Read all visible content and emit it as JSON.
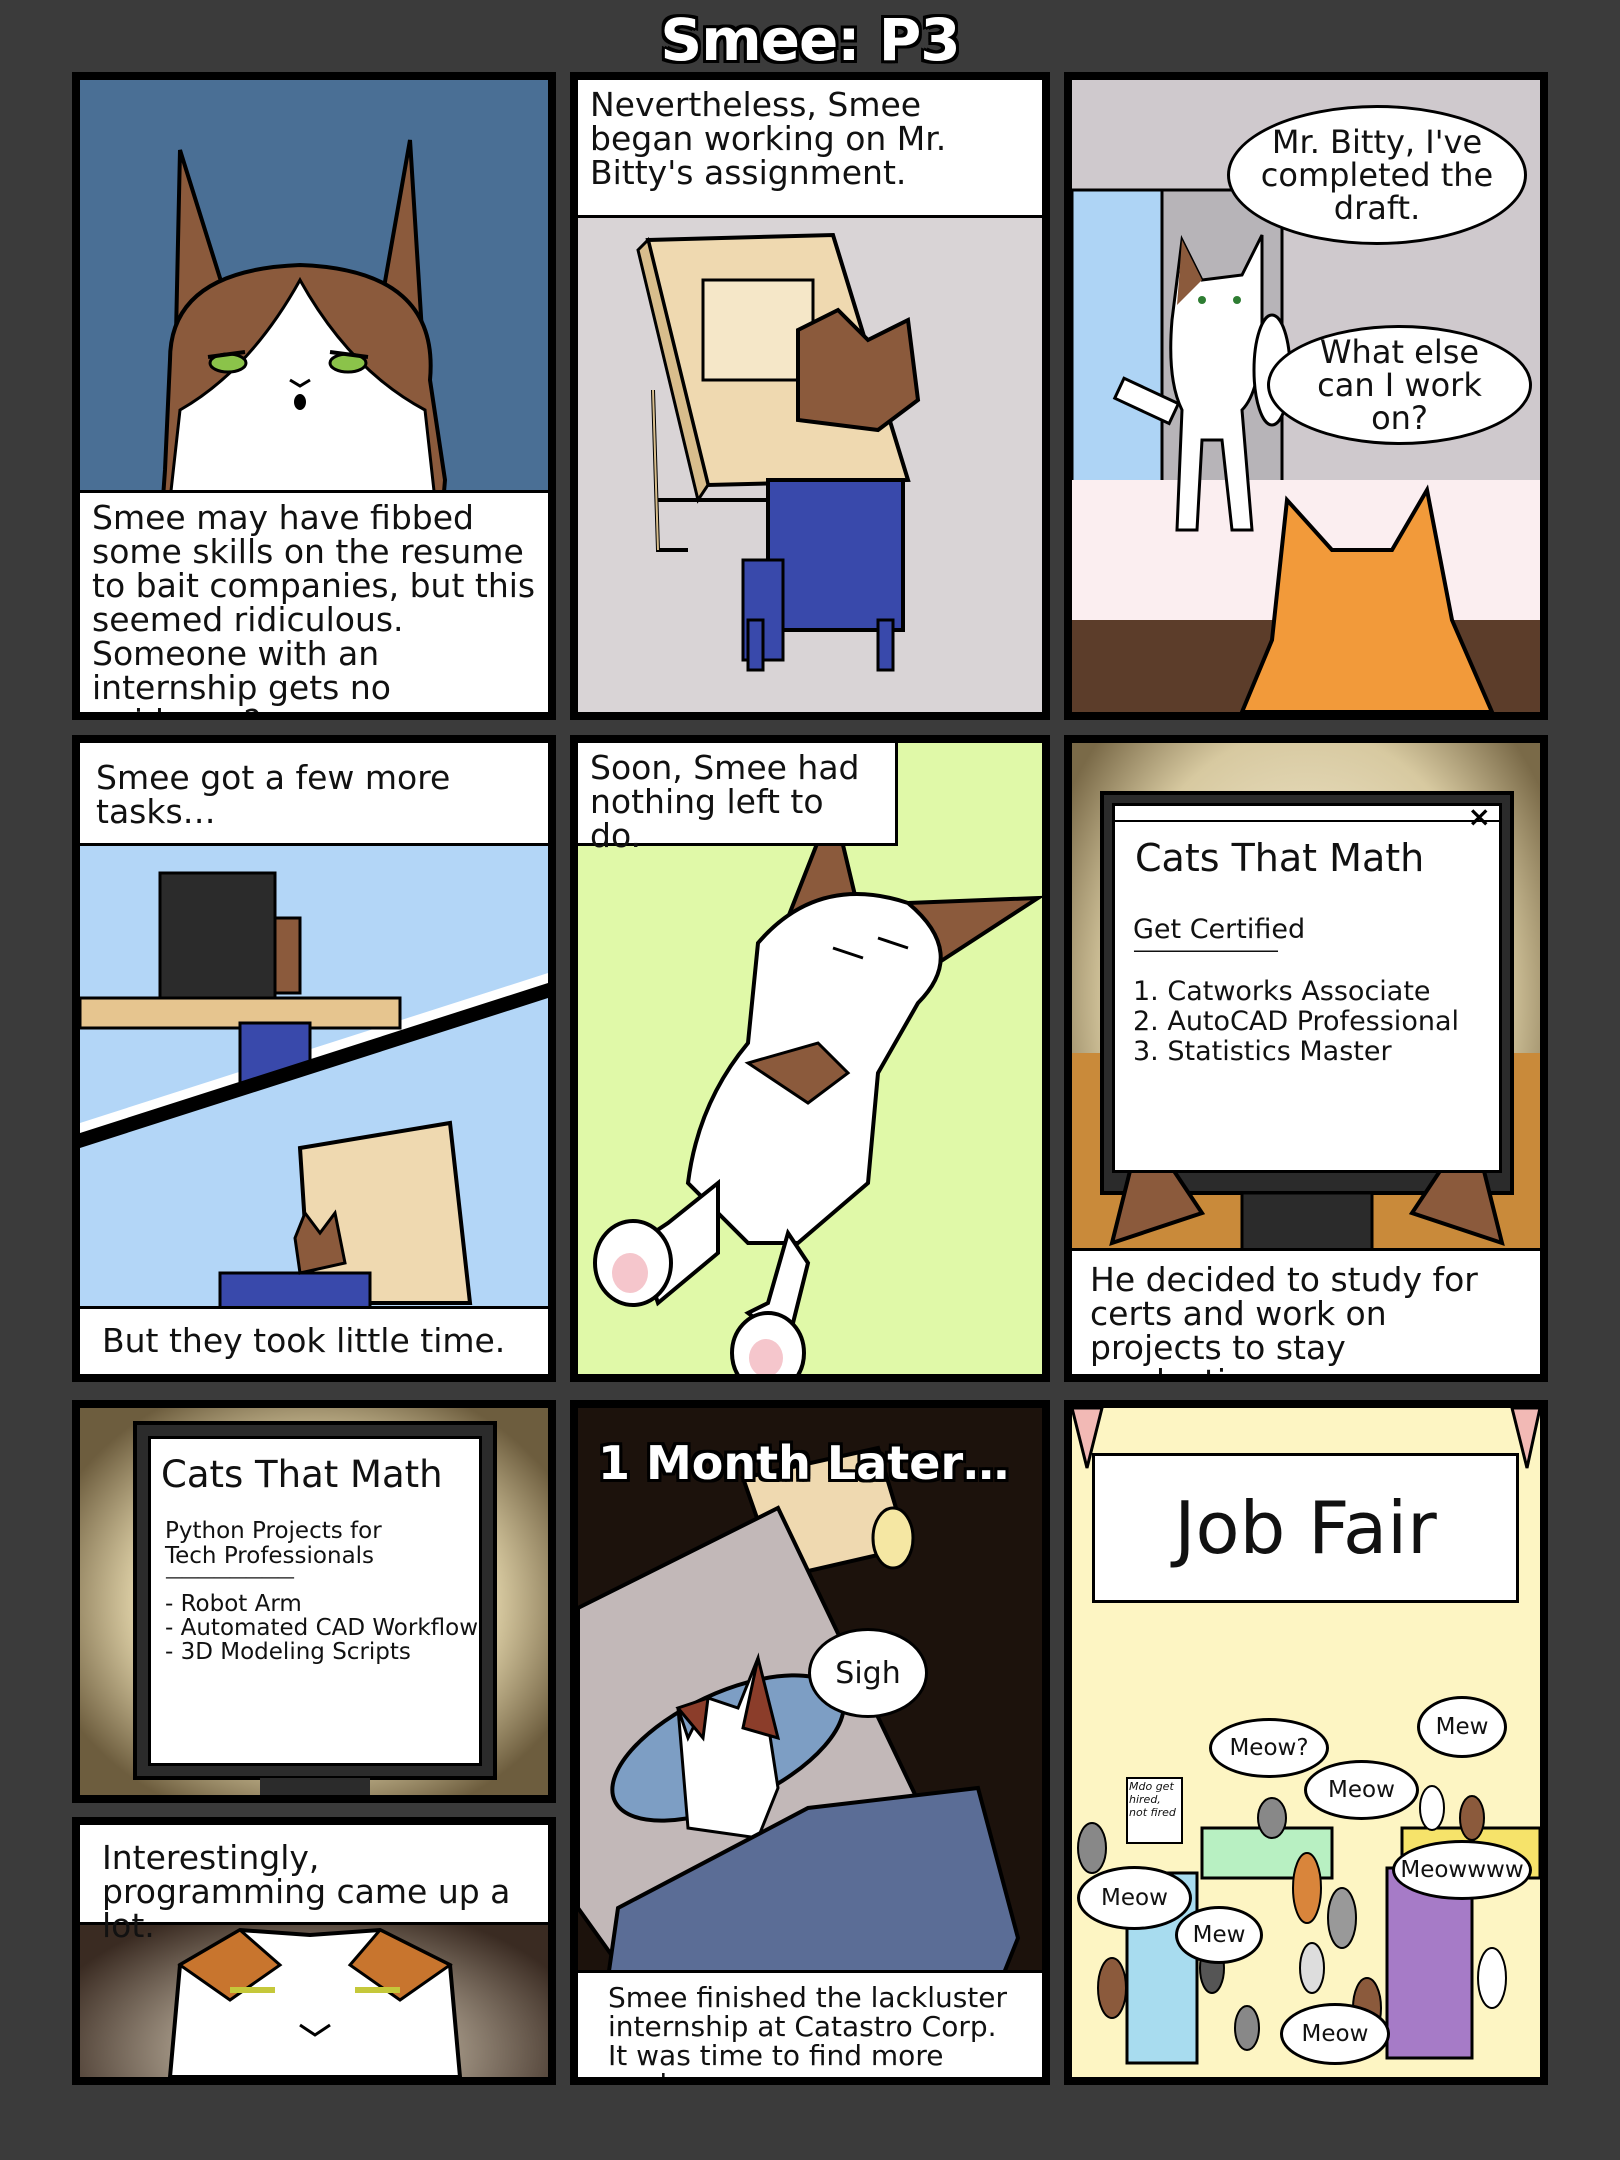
{
  "page_title": "Smee: P3",
  "panel1": {
    "caption": "Smee may have fibbed some skills on the resume to bait companies, but this seemed ridiculous. Someone with an internship gets no guidance?"
  },
  "panel2": {
    "caption": "Nevertheless, Smee began working on Mr. Bitty's assignment."
  },
  "panel3": {
    "bubble1": "Mr. Bitty, I've completed the draft.",
    "bubble2": "What else can I work on?"
  },
  "panel4": {
    "caption_top": "Smee got a few more tasks…",
    "caption_bottom": "But they took little time."
  },
  "panel5": {
    "caption": "Soon, Smee had nothing left to do."
  },
  "panel6": {
    "screen_title": "Cats That Math",
    "screen_subtitle": "Get Certified",
    "screen_divider": "————————",
    "screen_items": [
      "1. Catworks Associate",
      "2. AutoCAD Professional",
      "3. Statistics Master"
    ],
    "close_icon": "×",
    "caption": "He decided to study for certs and work on projects to stay productive."
  },
  "panel7": {
    "screen_title": "Cats That Math",
    "screen_subtitle": "Python Projects for Tech Professionals",
    "screen_divider": "————————",
    "screen_items": [
      "- Robot Arm",
      "- Automated CAD Workflow",
      "- 3D Modeling Scripts"
    ]
  },
  "panel7b": {
    "caption": "Interestingly, programming came up a lot."
  },
  "panel8": {
    "heading": "1 Month Later…",
    "bubble": "Sigh",
    "caption": "Smee finished the lackluster internship at Catastro Corp. It was time to find more work."
  },
  "panel9": {
    "banner": "Job Fair",
    "sign_text": "Mdo get hired, not fired",
    "bubbles": [
      "Meow?",
      "Mew",
      "Meow",
      "Meowwww",
      "Meow",
      "Mew",
      "Meow"
    ]
  }
}
